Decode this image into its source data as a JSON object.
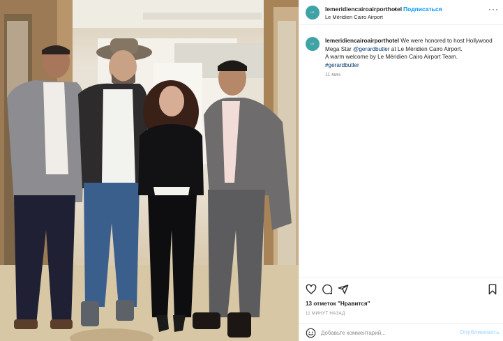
{
  "post": {
    "account": {
      "username": "lemeridiencairoairporthotel",
      "avatar_text": "LE MERIDIEN",
      "brand_color": "#3fa3a6",
      "location": "Le Méridien Cairo Airport"
    },
    "header": {
      "separator": "•",
      "follow_label": "Подписаться",
      "more_label": "···",
      "more_icon": "more-horizontal-icon"
    },
    "caption": {
      "username": "lemeridiencairoairporthotel",
      "part1": " We were honored to host Hollywood Mega Star ",
      "mention": "@gerardbutler",
      "part2": " at Le Méridien Cairo Airport.",
      "line2": "A warm welcome by Le Méridien Cairo Airport Team.",
      "hashtag": "#gerardbutler",
      "time": "11 мин."
    },
    "actions": {
      "icons": [
        "heart-icon",
        "comment-icon",
        "share-icon",
        "bookmark-icon"
      ],
      "likes_text": "13 отметок \"Нравится\"",
      "time_ago": "11 МИНУТ НАЗАД"
    },
    "comment_box": {
      "placeholder": "Добавьте комментарий...",
      "post_label": "Опубликовать",
      "emoji_icon": "emoji-icon"
    },
    "photo": {
      "description_icon": "photo"
    }
  }
}
